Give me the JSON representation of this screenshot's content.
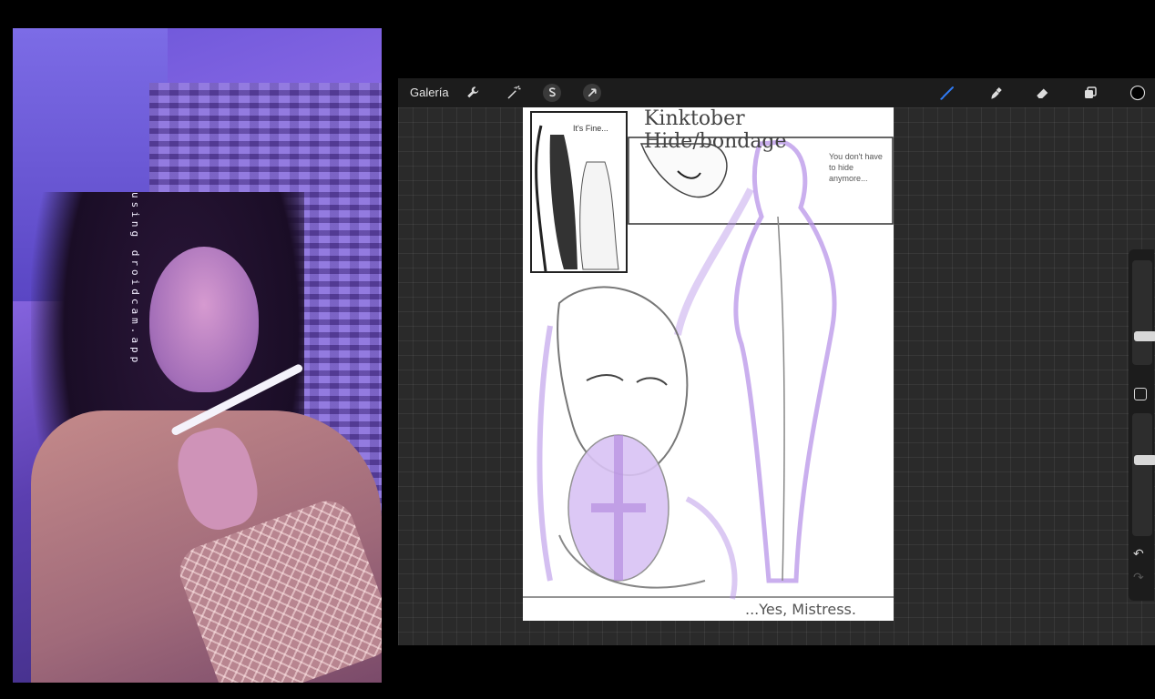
{
  "webcam": {
    "watermark": "using droidcam.app"
  },
  "app": {
    "toolbar": {
      "gallery_label": "Galería",
      "actions_icon": "wrench-icon",
      "adjustments_icon": "magic-wand-icon",
      "selection_icon": "selection-s-icon",
      "transform_icon": "arrow-cursor-icon",
      "brush_icon": "brush-icon",
      "smudge_icon": "smudge-icon",
      "eraser_icon": "eraser-icon",
      "layers_icon": "layers-icon",
      "active_color": "#000000",
      "brush_active_color": "#2f7bf5"
    },
    "canvas": {
      "title_text": "Kinktober Hide/bondage",
      "panel1_text": "It's Fine...",
      "speech_text": "You don't have to hide anymore...",
      "caption_text": "...Yes, Mistress.",
      "sketch_color": "#c8a8ee",
      "line_color": "#6a6a6a"
    },
    "sidebar": {
      "undo_icon": "undo-icon",
      "redo_icon": "redo-icon",
      "modify_icon": "square-icon",
      "brush_size": 0.25,
      "opacity": 0.63
    }
  }
}
